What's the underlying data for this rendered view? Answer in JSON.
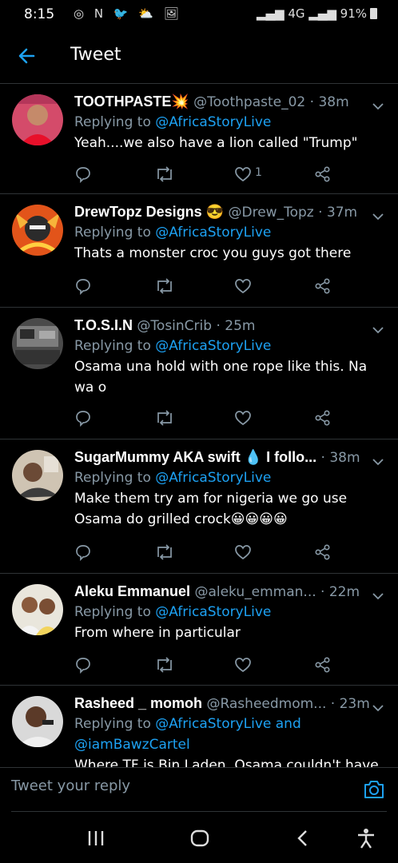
{
  "status_bar": {
    "time": "8:15",
    "icons": "◎ N 🐦 ⛅ 🖼",
    "network": "4G",
    "battery": "91%"
  },
  "header": {
    "title": "Tweet"
  },
  "tweets": [
    {
      "name": "TOOTHPASTE💥",
      "handle": "@Toothpaste_02",
      "time": "38m",
      "replying_label": "Replying to",
      "mentions": "@AfricaStoryLive",
      "text": "Yeah....we also have a lion called \"Trump\"",
      "like_count": "1"
    },
    {
      "name": "DrewTopz Designs 😎",
      "handle": "@Drew_Topz",
      "time": "37m",
      "replying_label": "Replying to",
      "mentions": "@AfricaStoryLive",
      "text": "Thats a monster croc you guys got there",
      "like_count": ""
    },
    {
      "name": "T.O.S.I.N",
      "handle": "@TosinCrib",
      "time": "25m",
      "replying_label": "Replying to",
      "mentions": "@AfricaStoryLive",
      "text": "Osama una hold with one rope like this. Na wa o",
      "like_count": ""
    },
    {
      "name": "SugarMummy AKA swift 💧 I follo...",
      "handle": "",
      "time": "38m",
      "replying_label": "Replying to",
      "mentions": "@AfricaStoryLive",
      "text": "Make them try am for nigeria we go use Osama do grilled crock😀😀😀😀",
      "like_count": ""
    },
    {
      "name": "Aleku Emmanuel",
      "handle": "@aleku_emman...",
      "time": "22m",
      "replying_label": "Replying to",
      "mentions": "@AfricaStoryLive",
      "text": "From where in particular",
      "like_count": ""
    },
    {
      "name": "Rasheed _ momoh",
      "handle": "@Rasheedmom...",
      "time": "23m",
      "replying_label": "Replying to",
      "mentions": "@AfricaStoryLive and @iamBawzCartel",
      "text": "Where TF is Bin Laden. Osama couldn't have",
      "like_count": ""
    }
  ],
  "compose": {
    "placeholder": "Tweet your reply"
  },
  "colors": {
    "accent": "#1da1f2",
    "muted": "#8899a6",
    "divider": "#2f3336",
    "background": "#000000"
  },
  "icons": [
    "back-arrow-icon",
    "chevron-down-icon",
    "reply-icon",
    "retweet-icon",
    "heart-icon",
    "share-icon",
    "camera-icon",
    "recents-icon",
    "home-icon",
    "back-icon",
    "accessibility-icon"
  ]
}
